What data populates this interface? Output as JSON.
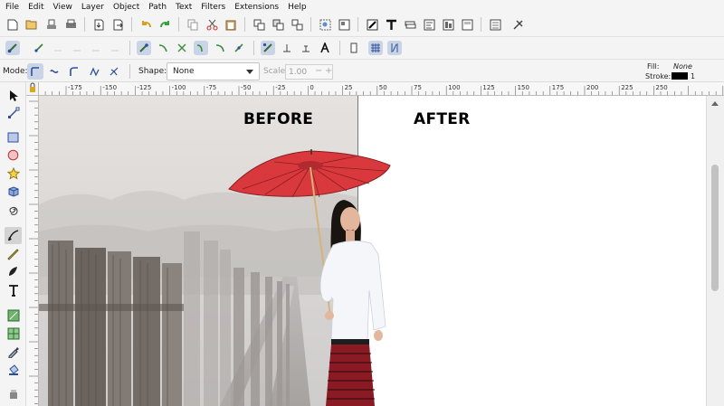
{
  "menu": [
    "File",
    "Edit",
    "View",
    "Layer",
    "Object",
    "Path",
    "Text",
    "Filters",
    "Extensions",
    "Help"
  ],
  "controls": {
    "mode_label": "Mode:",
    "shape_label": "Shape:",
    "shape_value": "None",
    "scale_label": "Scale:",
    "scale_value": "1.00",
    "fill_label": "Fill:",
    "fill_value": "None",
    "stroke_label": "Stroke:",
    "stroke_width": "1"
  },
  "ruler_labels": [
    "-175",
    "-150",
    "-125",
    "-100",
    "-75",
    "-50",
    "-25",
    "0",
    "25",
    "50",
    "75",
    "100",
    "125",
    "150",
    "175",
    "200",
    "225",
    "250"
  ],
  "canvas": {
    "before_label": "BEFORE",
    "after_label": "AFTER"
  },
  "colors": {
    "umbrella": "#d9393c",
    "skirt": "#8a1b25",
    "stroke_swatch": "#000000",
    "active_tool_bg": "#d3d3d3"
  },
  "icons": {
    "active_tool": "pen-icon"
  }
}
